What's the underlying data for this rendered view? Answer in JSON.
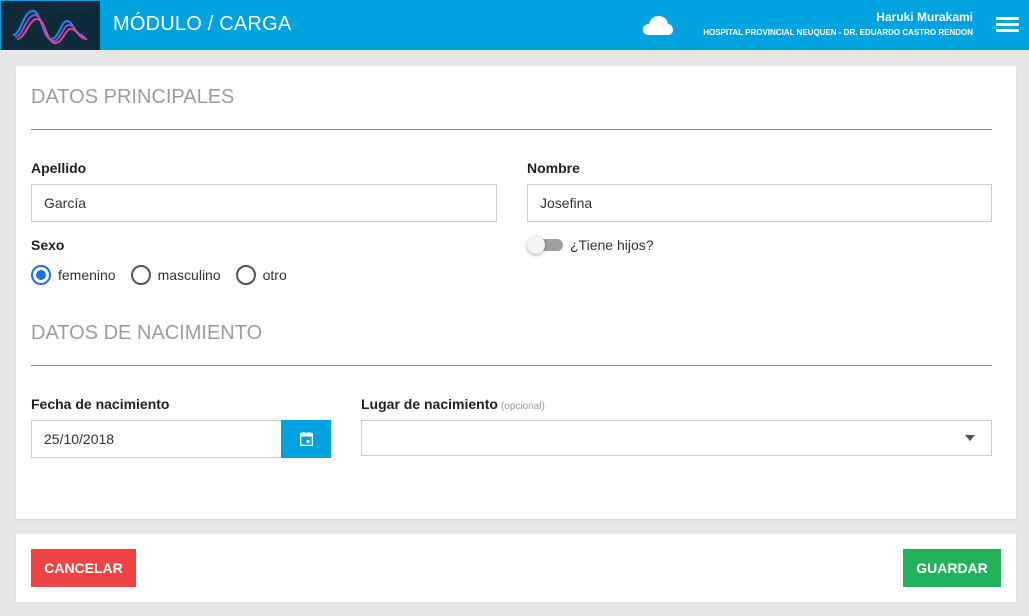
{
  "header": {
    "title": "MÓDULO / CARGA",
    "user_name": "Haruki Murakami",
    "organization": "HOSPITAL PROVINCIAL NEUQUEN - DR. EDUARDO CASTRO RENDON",
    "icons": {
      "status": "cloud-icon",
      "menu": "hamburger-menu-icon"
    },
    "colors": {
      "bar": "#00a2e0",
      "logo_bg": "#0e2a3b"
    }
  },
  "sections": {
    "principal": "DATOS PRINCIPALES",
    "nacimiento": "DATOS DE NACIMIENTO"
  },
  "form": {
    "apellido": {
      "label": "Apellido",
      "value": "García"
    },
    "nombre": {
      "label": "Nombre",
      "value": "Josefina"
    },
    "sexo": {
      "label": "Sexo",
      "options": [
        "femenino",
        "masculino",
        "otro"
      ],
      "selected": "femenino"
    },
    "hijos": {
      "label": "¿Tiene hijos?",
      "value": false
    },
    "fecha": {
      "label": "Fecha de nacimiento",
      "value": "25/10/2018"
    },
    "lugar": {
      "label": "Lugar de nacimiento",
      "optional": "(opcional)",
      "value": ""
    }
  },
  "actions": {
    "cancel": "CANCELAR",
    "save": "GUARDAR"
  }
}
